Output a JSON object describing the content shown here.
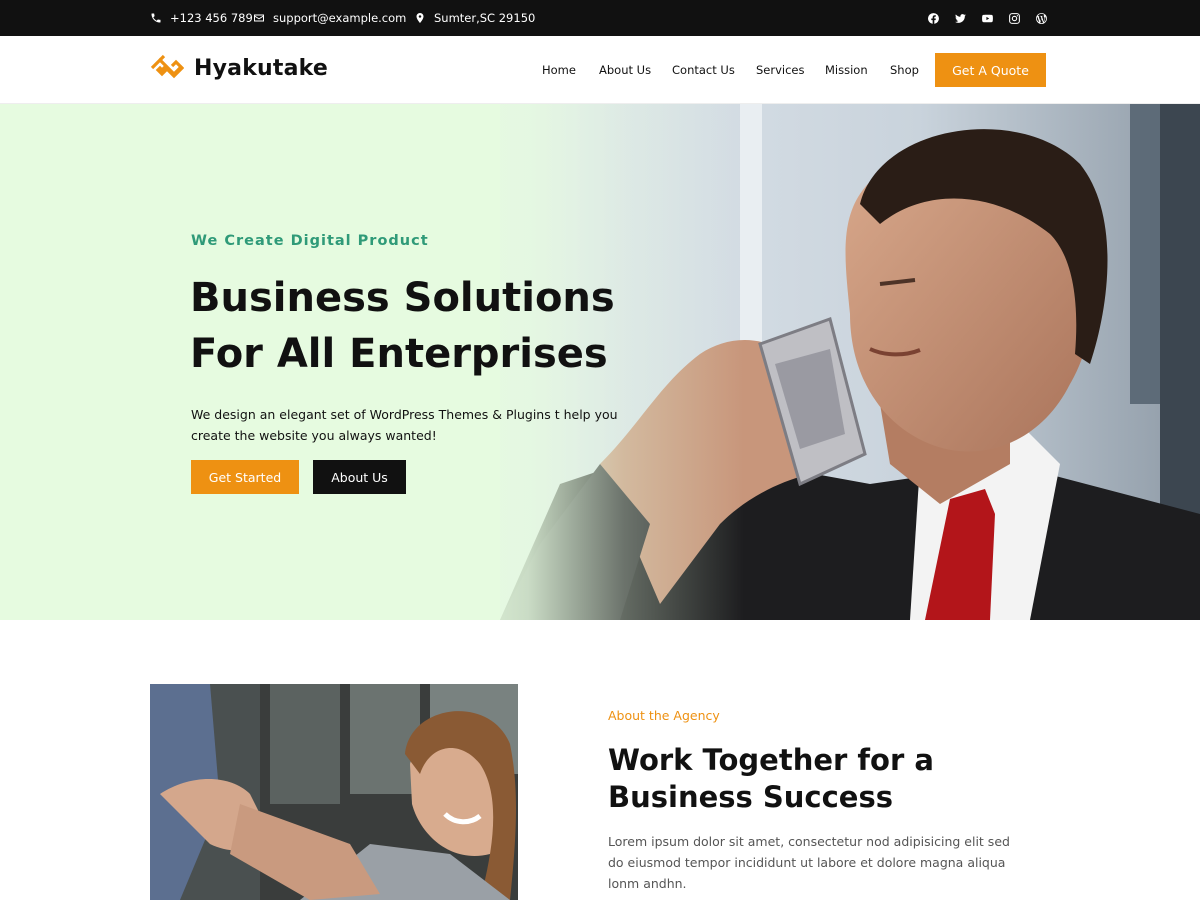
{
  "topbar": {
    "phone": "+123 456 789",
    "email": "support@example.com",
    "address": "Sumter,SC 29150",
    "socials": [
      "facebook-icon",
      "twitter-icon",
      "youtube-icon",
      "instagram-icon",
      "wordpress-icon"
    ]
  },
  "header": {
    "logo_text": "Hyakutake",
    "nav": [
      "Home",
      "About Us",
      "Contact Us",
      "Services",
      "Mission",
      "Shop"
    ],
    "cta_label": "Get A Quote"
  },
  "hero": {
    "eyebrow": "We Create Digital Product",
    "title_line1": "Business Solutions",
    "title_line2": "For All Enterprises",
    "description": "We design an elegant set of WordPress Themes & Plugins t help you create the website you always wanted!",
    "primary_button": "Get Started",
    "secondary_button": "About Us"
  },
  "about": {
    "eyebrow": "About the Agency",
    "title_line1": "Work Together for a",
    "title_line2": "Business Success",
    "description": "Lorem ipsum dolor sit amet, consectetur nod adipisicing elit sed do eiusmod tempor incididunt ut labore et dolore magna aliqua lonm andhn."
  },
  "colors": {
    "accent": "#ee9112",
    "dark": "#111111",
    "hero_bg": "#e6fbe0",
    "eyebrow_green": "#2f9a78"
  }
}
